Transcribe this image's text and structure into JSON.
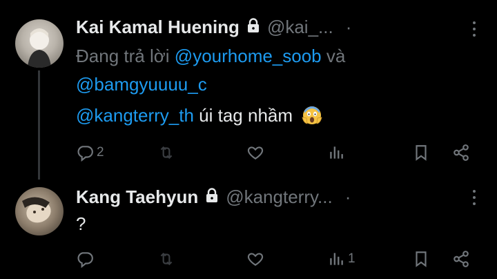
{
  "tweets": [
    {
      "name": "Kai Kamal Huening",
      "handle": "@kai_...",
      "separator": "·",
      "replying_prefix": "Đang trả lời",
      "mention1": "@yourhome_soob",
      "conjunction": "và",
      "mention2": "@bamgyuuuu_c",
      "mention3": "@kangterry_th",
      "text_after": "úi tag nhầm",
      "emoji": "screaming-face-emoji",
      "reply_count": "2"
    },
    {
      "name": "Kang Taehyun",
      "handle": "@kangterry...",
      "separator": "·",
      "text": "?",
      "trailing_count": "1"
    }
  ],
  "colors": {
    "background": "#000000",
    "text": "#e7e9ea",
    "muted": "#71767b",
    "link": "#1d9bf0"
  },
  "icons": [
    "lock-icon",
    "more-icon",
    "reply-icon",
    "retweet-icon",
    "like-icon",
    "views-icon",
    "bookmark-icon",
    "share-icon"
  ]
}
